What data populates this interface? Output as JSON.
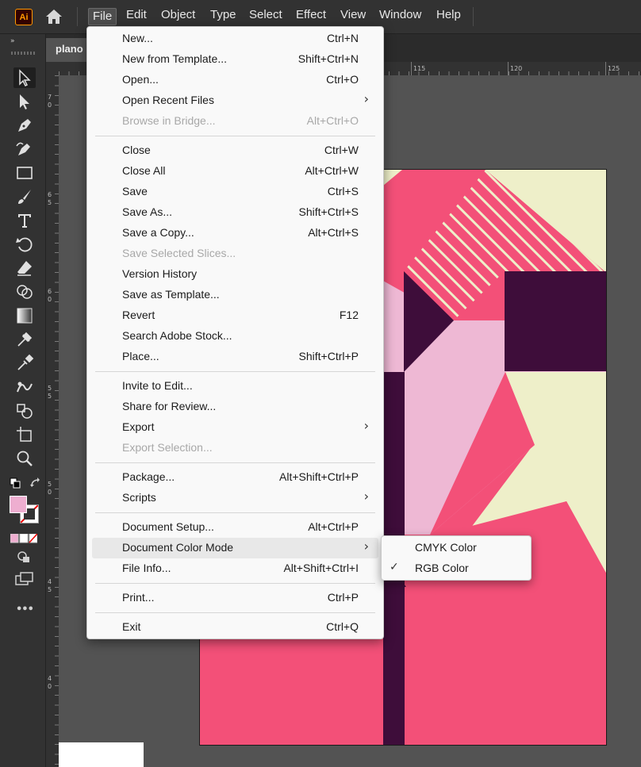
{
  "app": {
    "logo_text": "Ai",
    "document_tab": "plano"
  },
  "menubar": {
    "items": [
      "File",
      "Edit",
      "Object",
      "Type",
      "Select",
      "Effect",
      "View",
      "Window",
      "Help"
    ],
    "active": "File"
  },
  "toolbar": {
    "collapse_glyph": "»",
    "tools": [
      "selection-tool",
      "direct-selection-tool",
      "pen-tool",
      "curvature-tool",
      "rectangle-tool",
      "paintbrush-tool",
      "type-tool",
      "rotate-tool",
      "eraser-tool",
      "shape-builder-tool",
      "gradient-tool",
      "mesh-tool",
      "eyedropper-tool",
      "blend-tool",
      "symbol-sprayer-tool",
      "artboard-tool",
      "zoom-tool"
    ],
    "fill_color": "#eeaed0",
    "more_glyph": "•••"
  },
  "rulers": {
    "horizontal_labels": [
      "115",
      "120",
      "125"
    ],
    "vertical_labels": [
      [
        "7",
        "0"
      ],
      [
        "6",
        "5"
      ],
      [
        "6",
        "0"
      ],
      [
        "5",
        "5"
      ],
      [
        "5",
        "0"
      ],
      [
        "4",
        "5"
      ],
      [
        "4",
        "0"
      ]
    ]
  },
  "file_menu": {
    "items": [
      {
        "label": "New...",
        "shortcut": "Ctrl+N"
      },
      {
        "label": "New from Template...",
        "shortcut": "Shift+Ctrl+N"
      },
      {
        "label": "Open...",
        "shortcut": "Ctrl+O"
      },
      {
        "label": "Open Recent Files",
        "submenu": true
      },
      {
        "label": "Browse in Bridge...",
        "shortcut": "Alt+Ctrl+O",
        "disabled": true
      },
      {
        "label": "Close",
        "shortcut": "Ctrl+W"
      },
      {
        "label": "Close All",
        "shortcut": "Alt+Ctrl+W"
      },
      {
        "label": "Save",
        "shortcut": "Ctrl+S"
      },
      {
        "label": "Save As...",
        "shortcut": "Shift+Ctrl+S"
      },
      {
        "label": "Save a Copy...",
        "shortcut": "Alt+Ctrl+S"
      },
      {
        "label": "Save Selected Slices...",
        "disabled": true
      },
      {
        "label": "Version History"
      },
      {
        "label": "Save as Template..."
      },
      {
        "label": "Revert",
        "shortcut": "F12"
      },
      {
        "label": "Search Adobe Stock..."
      },
      {
        "label": "Place...",
        "shortcut": "Shift+Ctrl+P"
      },
      {
        "label": "Invite to Edit..."
      },
      {
        "label": "Share for Review..."
      },
      {
        "label": "Export",
        "submenu": true
      },
      {
        "label": "Export Selection...",
        "disabled": true
      },
      {
        "label": "Package...",
        "shortcut": "Alt+Shift+Ctrl+P"
      },
      {
        "label": "Scripts",
        "submenu": true
      },
      {
        "label": "Document Setup...",
        "shortcut": "Alt+Ctrl+P"
      },
      {
        "label": "Document Color Mode",
        "submenu": true,
        "highlighted": true
      },
      {
        "label": "File Info...",
        "shortcut": "Alt+Shift+Ctrl+I"
      },
      {
        "label": "Print...",
        "shortcut": "Ctrl+P"
      },
      {
        "label": "Exit",
        "shortcut": "Ctrl+Q"
      }
    ]
  },
  "color_mode_submenu": {
    "items": [
      {
        "label": "CMYK Color",
        "checked": false
      },
      {
        "label": "RGB Color",
        "checked": true
      }
    ],
    "check_glyph": "✓"
  },
  "artwork_colors": {
    "hot_pink": "#f35078",
    "light_pink": "#eeb8d4",
    "cream": "#eeefc9",
    "dark_plum": "#3e0d3a"
  }
}
